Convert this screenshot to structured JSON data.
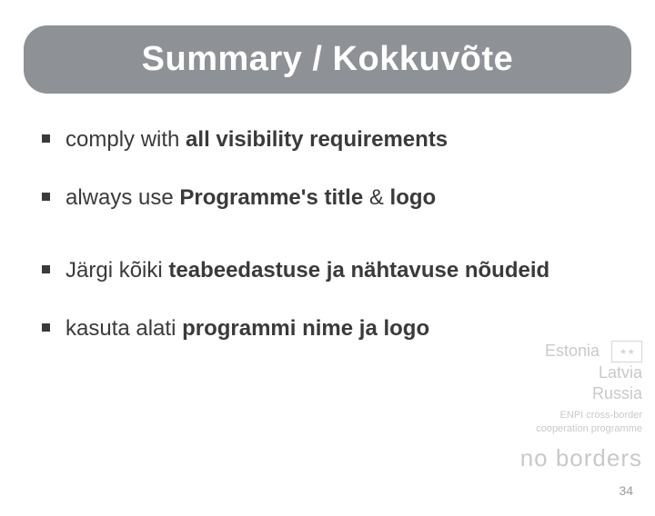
{
  "title": "Summary / Kokkuvõte",
  "bullets": [
    {
      "pre": "comply with ",
      "strong": "all visibility requirements",
      "post": ""
    },
    {
      "pre": "always use ",
      "strong": "Programme's title ",
      "post": "",
      "amp": "& ",
      "strong2": "logo"
    },
    {
      "pre": "Järgi kõiki ",
      "strong": "teabeedastuse ja nähtavuse nõudeid",
      "post": ""
    },
    {
      "pre": "kasuta alati ",
      "strong": "programmi nime ja logo",
      "post": ""
    }
  ],
  "watermark": {
    "countries": [
      "Estonia",
      "Latvia",
      "Russia"
    ],
    "small1": "ENPI cross-border",
    "small2": "cooperation programme",
    "tagline": "no borders"
  },
  "page_number": "34"
}
